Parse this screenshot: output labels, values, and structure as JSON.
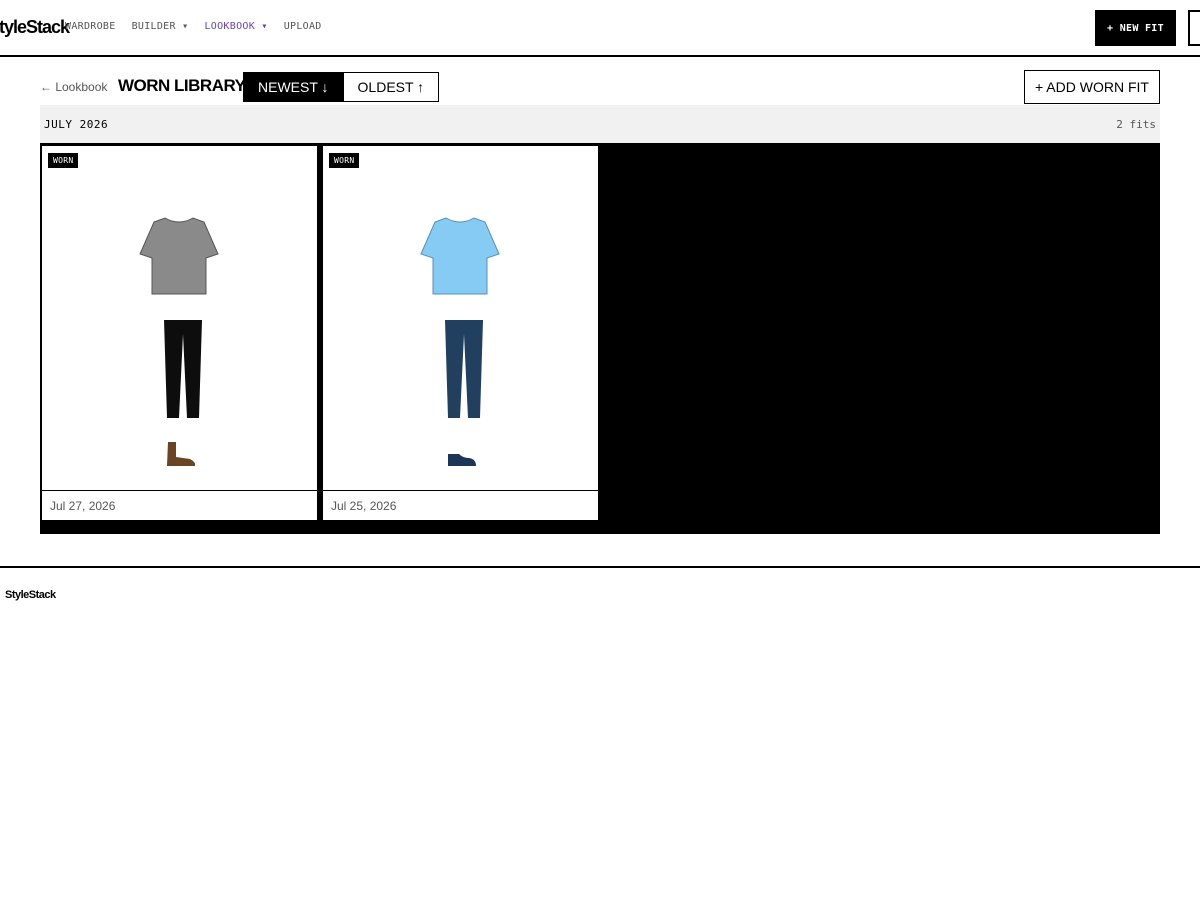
{
  "header": {
    "logo": "StyleStack",
    "nav": [
      {
        "label": "WARDROBE"
      },
      {
        "label": "BUILDER ▾"
      },
      {
        "label": "LOOKBOOK ▾"
      },
      {
        "label": "UPLOAD"
      }
    ],
    "new_fit_label": "+ NEW FIT",
    "active_color": "#6a3fc8"
  },
  "toolbar": {
    "back_label": "← Lookbook",
    "title": "WORN LIBRARY",
    "sort_newest": "NEWEST ↓",
    "sort_oldest": "OLDEST ↑",
    "add_worn_label": "+ ADD WORN FIT"
  },
  "group": {
    "month": "JULY 2026",
    "count": "2 fits"
  },
  "cards": [
    {
      "badge": "WORN",
      "date": "Jul 27, 2026",
      "top_color": "#8a8a8a",
      "bottom_color": "#0d0d0d",
      "shoe_color": "#6b4424",
      "shoe_icon": "boot-icon"
    },
    {
      "badge": "WORN",
      "date": "Jul 25, 2026",
      "top_color": "#86cbf4",
      "bottom_color": "#213f5e",
      "shoe_color": "#1d3557",
      "shoe_icon": "sneaker-icon"
    }
  ],
  "footer": {
    "logo": "StyleStack"
  }
}
